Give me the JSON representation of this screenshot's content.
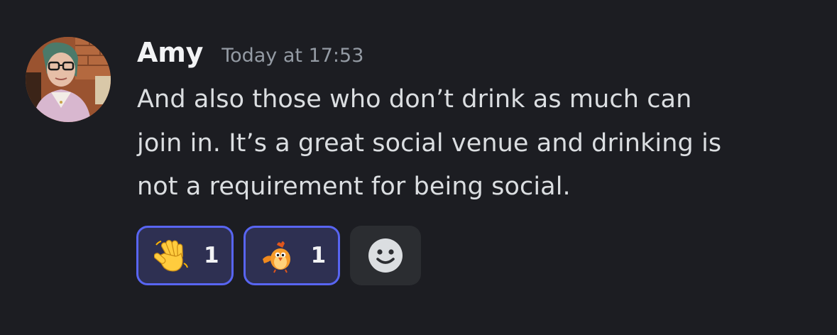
{
  "message": {
    "author": "Amy",
    "timestamp": "Today at 17:53",
    "lines": [
      "And also those who don’t drink as much can",
      "join in. It’s a great social venue and drinking is",
      "not a requirement for being social."
    ],
    "avatar": {
      "icon": "user-avatar-photo"
    }
  },
  "reactions": [
    {
      "emoji": "waving-hand-emoji",
      "count": "1",
      "active": true
    },
    {
      "emoji": "bird-mascot-emoji",
      "count": "1",
      "active": true
    }
  ],
  "add_reaction": {
    "icon": "smiley-face-icon"
  },
  "colors": {
    "background": "#1c1d22",
    "author": "#f2f3f5",
    "timestamp": "#949ba4",
    "text": "#dbdee1",
    "reaction_border": "#5865f2",
    "reaction_fill": "#2e3052",
    "add_reaction_fill": "#2b2d31"
  }
}
